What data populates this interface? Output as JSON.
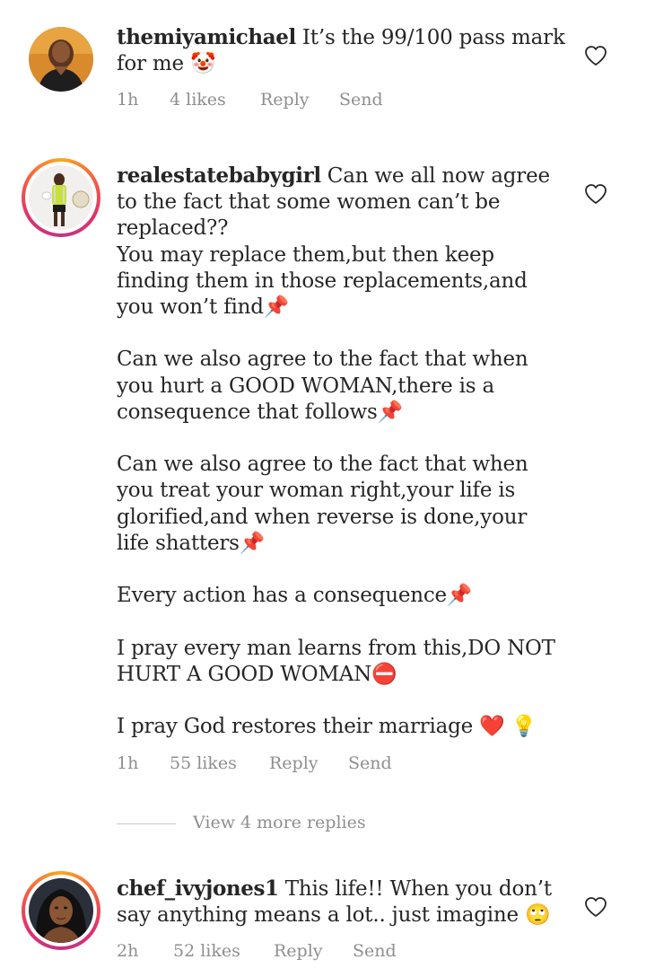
{
  "comments": [
    {
      "username": "themiyamichael",
      "paragraphs": [
        "It’s the 99/100 pass mark for me 🤡"
      ],
      "time": "1h",
      "likes": "4 likes",
      "reply_label": "Reply",
      "send_label": "Send"
    },
    {
      "username": "realestatebabygirl",
      "paragraphs": [
        "Can we all now agree to the fact that some women can’t be replaced??",
        "You may replace them,but then keep finding them in those replacements,and you won’t find📌",
        "Can we also agree to the fact that when you hurt a GOOD WOMAN,there is a consequence that follows📌",
        "Can we also agree to the fact that when you treat your woman right,your life is glorified,and when reverse is done,your life shatters📌",
        "Every action has a consequence📌",
        "I pray every man learns from this,DO NOT HURT A GOOD WOMAN⛔",
        "I pray God restores their marriage ❤️ 💡"
      ],
      "time": "1h",
      "likes": "55 likes",
      "reply_label": "Reply",
      "send_label": "Send",
      "view_replies": "View 4 more replies"
    },
    {
      "username": "chef_ivyjones1",
      "paragraphs": [
        "This life!! When you don’t say anything means a lot.. just imagine 🙄"
      ],
      "time": "2h",
      "likes": "52 likes",
      "reply_label": "Reply",
      "send_label": "Send"
    }
  ],
  "icons": {
    "like": "heart-outline-icon",
    "story_ring": "story-ring"
  },
  "colors": {
    "text": "#262626",
    "meta": "#8e8e8e",
    "story_ring_start": "#f9a825",
    "story_ring_end": "#c13584"
  }
}
